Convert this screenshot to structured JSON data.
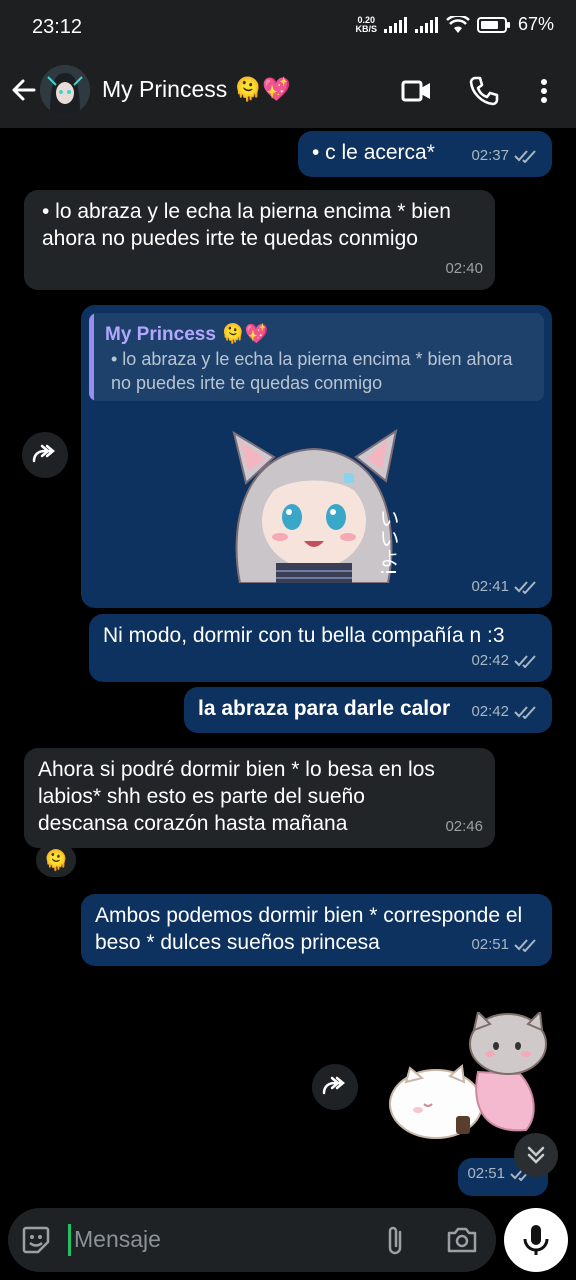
{
  "status_bar": {
    "time": "23:12",
    "net_speed_value": "0.20",
    "net_speed_unit": "KB/S",
    "battery": "67%"
  },
  "header": {
    "contact_name": "My Princess 🫠💖",
    "icons": [
      "back-arrow-icon",
      "video-call-icon",
      "phone-icon",
      "more-icon"
    ]
  },
  "messages": [
    {
      "dir": "out",
      "text": "•  c le acerca*",
      "time": "02:37"
    },
    {
      "dir": "in",
      "text": "•  lo abraza y le echa la pierna encima * bien ahora no puedes irte te quedas conmigo",
      "time": "02:40"
    },
    {
      "dir": "out",
      "type": "sticker-reply",
      "quote_name": "My Princess 🫠💖",
      "quote_text": "•  lo abraza y le echa la pierna encima * bien ahora no puedes irte te quedas conmigo",
      "sticker": "anime-cat-girl-sticker",
      "sticker_text": "いいよ!",
      "time": "02:41"
    },
    {
      "dir": "out",
      "text": "Ni modo, dormir con tu bella compañía n :3",
      "time": "02:42"
    },
    {
      "dir": "out",
      "text": "la abraza para darle calor",
      "bold": true,
      "time": "02:42"
    },
    {
      "dir": "in",
      "text": "Ahora si podré dormir bien * lo besa en los labios* shh esto es parte del sueño descansa corazón hasta mañana",
      "time": "02:46",
      "reaction": "🫠"
    },
    {
      "dir": "out",
      "text": "Ambos podemos dormir bien * corresponde el beso * dulces sueños princesa",
      "time": "02:51"
    },
    {
      "dir": "out",
      "type": "sticker",
      "sticker": "cuddling-cats-sticker",
      "time": "02:51"
    }
  ],
  "composer": {
    "placeholder": "Mensaje"
  },
  "colors": {
    "outgoing_bubble": "#0d3260",
    "incoming_bubble": "#222527",
    "quote_accent": "#9b8cf0",
    "cursor": "#21c063"
  }
}
